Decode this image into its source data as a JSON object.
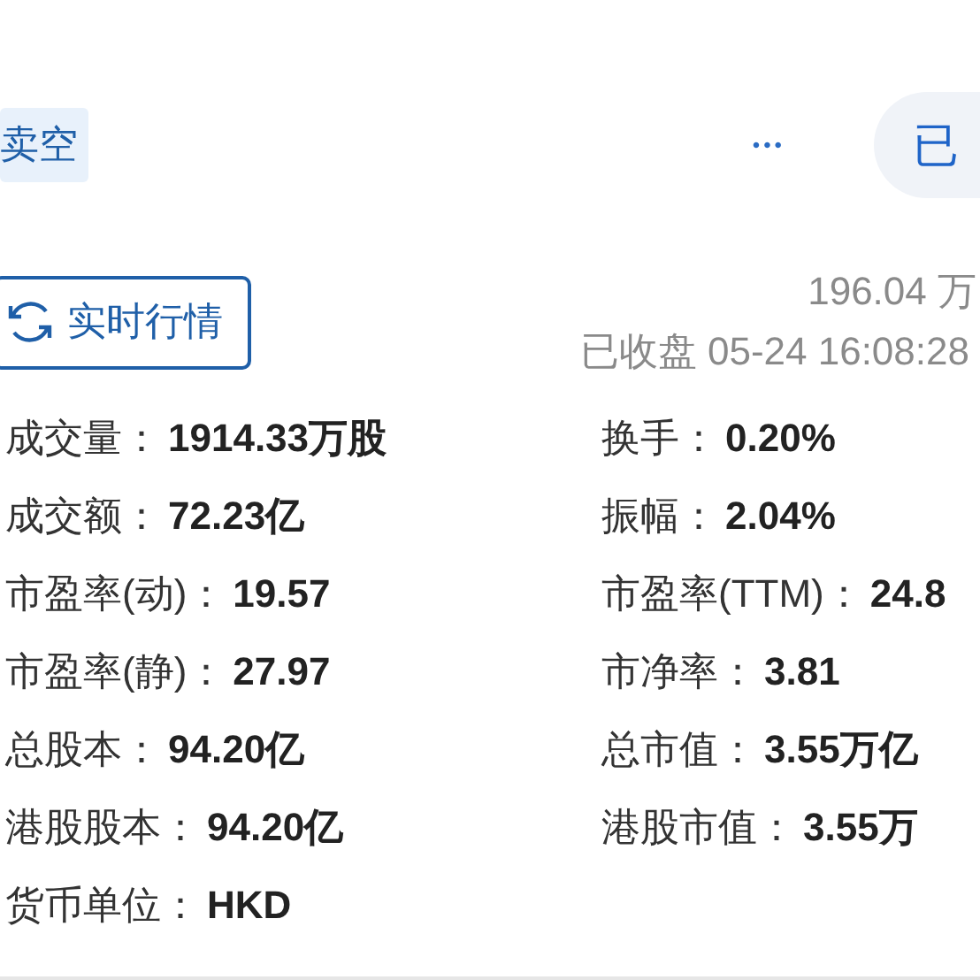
{
  "header": {
    "tag": "卖空",
    "more_icon": "•••",
    "action_button": "已"
  },
  "quote": {
    "refresh_button": "实时行情",
    "amount": "196.04 万",
    "status": "已收盘 05-24 16:08:28"
  },
  "stats": [
    {
      "label": "成交量：",
      "value": "1914.33万股"
    },
    {
      "label": "换手：",
      "value": "0.20%"
    },
    {
      "label": "成交额：",
      "value": "72.23亿"
    },
    {
      "label": "振幅：",
      "value": "2.04%"
    },
    {
      "label": "市盈率(动)：",
      "value": "19.57"
    },
    {
      "label": "市盈率(TTM)：",
      "value": "24.8"
    },
    {
      "label": "市盈率(静)：",
      "value": "27.97"
    },
    {
      "label": "市净率：",
      "value": "3.81"
    },
    {
      "label": "总股本：",
      "value": "94.20亿"
    },
    {
      "label": "总市值：",
      "value": "3.55万亿"
    },
    {
      "label": "港股股本：",
      "value": "94.20亿"
    },
    {
      "label": "港股市值：",
      "value": "3.55万"
    },
    {
      "label": "货币单位：",
      "value": "HKD"
    }
  ]
}
